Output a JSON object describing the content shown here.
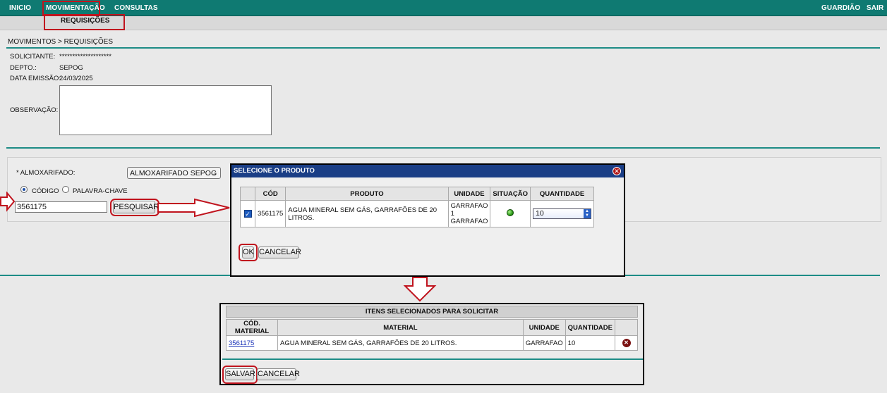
{
  "topbar": {
    "menu": [
      "INICIO",
      "MOVIMENTAÇÃO",
      "CONSULTAS"
    ],
    "right": [
      "GUARDIÃO",
      "SAIR"
    ],
    "submenu": "REQUISIÇÕES"
  },
  "breadcrumb": {
    "parent": "MOVIMENTOS",
    "sep": ">",
    "current": "REQUISIÇÕES"
  },
  "form": {
    "solicitante_label": "SOLICITANTE:",
    "solicitante_value": "********************",
    "depto_label": "DEPTO.:",
    "depto_value": "SEPOG",
    "data_label": "DATA EMISSÃO:",
    "data_value": "24/03/2025",
    "obs_label": "OBSERVAÇÃO:",
    "obs_value": ""
  },
  "search": {
    "almox_label": "* ALMOXARIFADO:",
    "almox_value": "ALMOXARIFADO SEPOG",
    "radio_codigo": "CÓDIGO",
    "radio_palavra": "PALAVRA-CHAVE",
    "selected_mode": "CÓDIGO",
    "code_value": "3561175",
    "search_button": "PESQUISAR"
  },
  "dialog": {
    "title": "SELECIONE O PRODUTO",
    "columns": [
      "",
      "CÓD",
      "PRODUTO",
      "UNIDADE",
      "SITUAÇÃO",
      "QUANTIDADE"
    ],
    "row": {
      "checked": true,
      "cod": "3561175",
      "produto": "AGUA MINERAL SEM GÁS, GARRAFÕES DE 20 LITROS.",
      "unidade_1": "GARRAFAO",
      "unidade_2": "1",
      "unidade_3": "GARRAFAO",
      "situacao": "green",
      "quantidade": "10"
    },
    "ok_button": "OK",
    "cancel_button": "CANCELAR"
  },
  "selected": {
    "caption": "ITENS SELECIONADOS PARA SOLICITAR",
    "columns": [
      "CÓD. MATERIAL",
      "MATERIAL",
      "UNIDADE",
      "QUANTIDADE",
      ""
    ],
    "rows": [
      {
        "cod": "3561175",
        "material": "AGUA MINERAL SEM GÁS, GARRAFÕES DE 20 LITROS.",
        "unidade": "GARRAFAO",
        "quantidade": "10"
      }
    ],
    "save_button": "SALVAR",
    "cancel_button": "CANCELAR"
  },
  "colors": {
    "teal": "#0f7a72",
    "highlight": "#c0141e",
    "dialog_title": "#1a3e86"
  }
}
